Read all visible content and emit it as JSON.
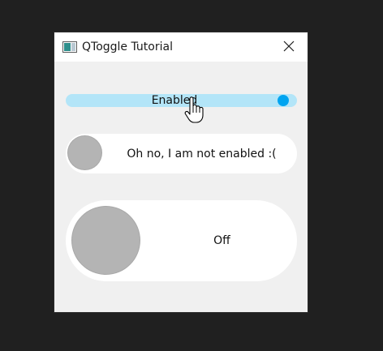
{
  "window": {
    "title": "QToggle Tutorial",
    "icon": "app-window-icon",
    "close_icon": "close-icon"
  },
  "toggles": [
    {
      "label": "Enabled",
      "checked": true,
      "enabled": true,
      "track_color": "#b3e5f8",
      "knob_color": "#00a4f0"
    },
    {
      "label": "Oh no, I am not enabled :(",
      "checked": false,
      "enabled": false,
      "track_color": "#ffffff",
      "knob_color": "#b4b4b4"
    },
    {
      "label": "Off",
      "checked": false,
      "enabled": true,
      "track_color": "#ffffff",
      "knob_color": "#b4b4b4"
    }
  ],
  "cursor": "hand-pointer-icon",
  "colors": {
    "desktop": "#202020",
    "window_bg": "#f0f0f0",
    "titlebar_bg": "#ffffff",
    "accent": "#00a4f0"
  }
}
